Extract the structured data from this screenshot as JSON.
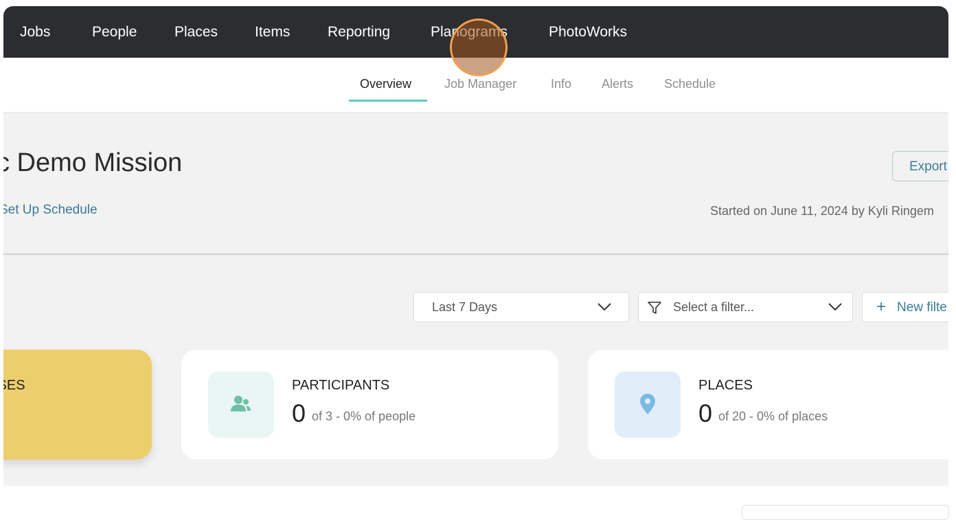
{
  "topnav": {
    "items": [
      "Jobs",
      "People",
      "Places",
      "Items",
      "Reporting",
      "Planograms",
      "PhotoWorks"
    ]
  },
  "subnav": {
    "tabs": [
      "Overview",
      "Job Manager",
      "Info",
      "Alerts",
      "Schedule"
    ],
    "active_tab": "Overview"
  },
  "header": {
    "title": "c Demo Mission",
    "export_label": "Export",
    "schedule_link": "Set Up Schedule",
    "started_text": "Started on June 11, 2024 by Kyli Ringem"
  },
  "filters": {
    "date_range": "Last 7 Days",
    "filter_placeholder": "Select a filter...",
    "new_filter_label": "New filte"
  },
  "cards": [
    {
      "label": "ISES",
      "color": "#edce6d"
    },
    {
      "label": "PARTICIPANTS",
      "count": "0",
      "detail": "of 3 - 0% of people",
      "icon": "people-icon",
      "icon_color": "#6fc0a6",
      "bg": "#e9f6f3"
    },
    {
      "label": "PLACES",
      "count": "0",
      "detail": "of 20 - 0% of places",
      "icon": "map-pin-icon",
      "icon_color": "#7ab9e6",
      "bg": "#e1eef9"
    }
  ],
  "colors": {
    "nav_bg": "#2b2d30",
    "accent": "#5ec8c8",
    "link": "#3a7a96"
  }
}
